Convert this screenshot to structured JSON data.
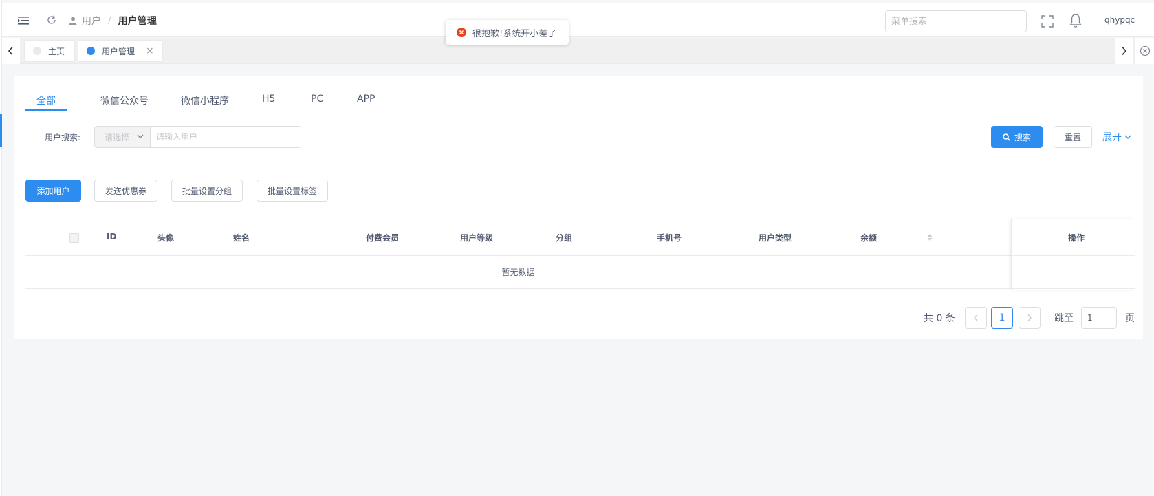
{
  "header": {
    "breadcrumb_parent": "用户",
    "breadcrumb_sep": "/",
    "breadcrumb_current": "用户管理",
    "menu_search_placeholder": "菜单搜索",
    "username": "qhypqc"
  },
  "toast": {
    "message": "很抱歉!系统开小差了",
    "status_color": "#ed4014"
  },
  "page_tabs": [
    {
      "label": "主页"
    },
    {
      "label": "用户管理",
      "close": "×"
    }
  ],
  "type_tabs": [
    "全部",
    "微信公众号",
    "微信小程序",
    "H5",
    "PC",
    "APP"
  ],
  "search": {
    "label": "用户搜索:",
    "select_placeholder": "请选择",
    "input_placeholder": "请输入用户",
    "search_button": "搜索",
    "reset_button": "重置",
    "expand_label": "展开"
  },
  "actions": {
    "add_user": "添加用户",
    "send_coupon": "发送优惠券",
    "batch_group": "批量设置分组",
    "batch_tag": "批量设置标签"
  },
  "table": {
    "columns": [
      "ID",
      "头像",
      "姓名",
      "付费会员",
      "用户等级",
      "分组",
      "手机号",
      "用户类型",
      "余额",
      "操作"
    ],
    "empty_text": "暂无数据"
  },
  "pagination": {
    "total_text": "共 0 条",
    "current_page": "1",
    "jump_label": "跳至",
    "jump_value": "1",
    "page_suffix": "页"
  },
  "colors": {
    "primary": "#2d8cf0",
    "error": "#ed4014"
  }
}
